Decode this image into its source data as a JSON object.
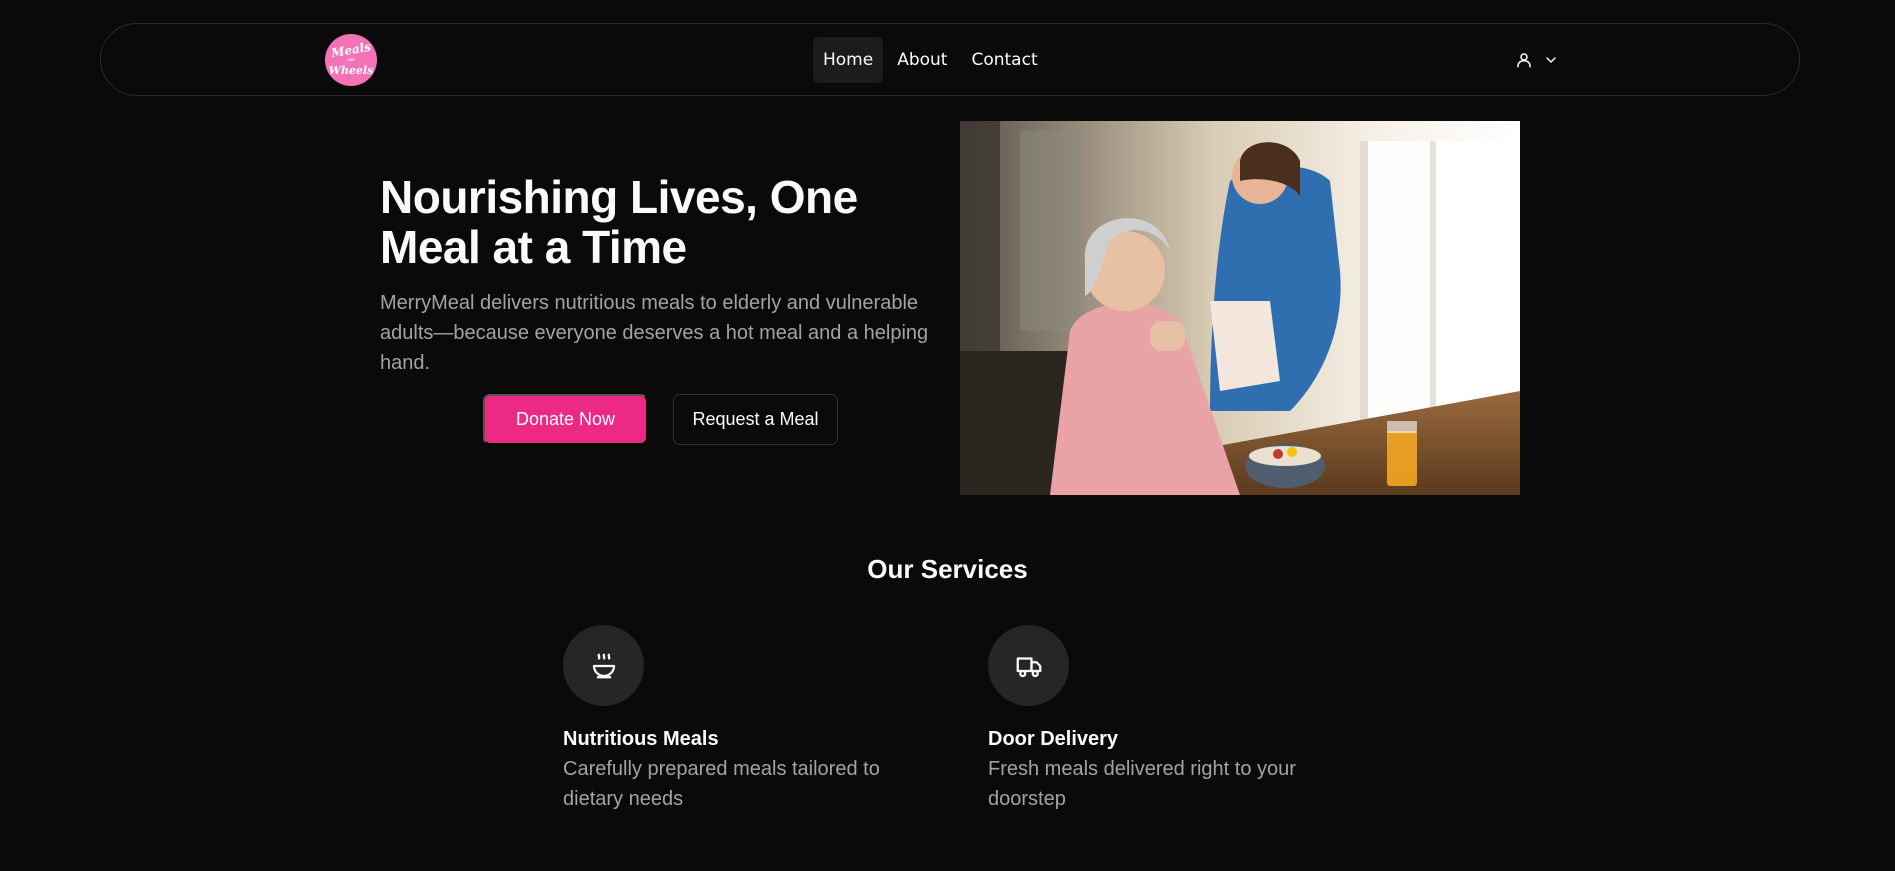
{
  "logo": {
    "line1": "Meals",
    "line2": "on",
    "line3": "Wheels"
  },
  "nav": {
    "items": [
      {
        "label": "Home",
        "active": true
      },
      {
        "label": "About",
        "active": false
      },
      {
        "label": "Contact",
        "active": false
      }
    ],
    "user_icon": "user-icon",
    "chevron_icon": "chevron-down-icon"
  },
  "hero": {
    "title": "Nourishing Lives, One Meal at a Time",
    "subtitle": "MerryMeal delivers nutritious meals to elderly and vulnerable adults—because everyone deserves a hot meal and a helping hand.",
    "donate_label": "Donate Now",
    "request_label": "Request a Meal"
  },
  "services": {
    "title": "Our Services",
    "items": [
      {
        "icon": "soup-bowl-icon",
        "title": "Nutritious Meals",
        "description": "Carefully prepared meals tailored to dietary needs"
      },
      {
        "icon": "truck-icon",
        "title": "Door Delivery",
        "description": "Fresh meals delivered right to your doorstep"
      }
    ]
  },
  "colors": {
    "background": "#0a0a0a",
    "accent": "#ec2a85",
    "logo": "#f472b6",
    "muted_text": "#a3a3a3"
  }
}
